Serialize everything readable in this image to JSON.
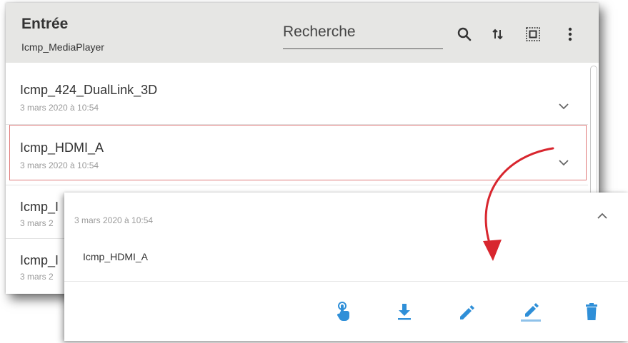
{
  "header": {
    "title": "Entrée",
    "subtitle": "Icmp_MediaPlayer",
    "search_placeholder": "Recherche",
    "icons": [
      "search-icon",
      "sort-icon",
      "select-all-icon",
      "more-vertical-icon"
    ]
  },
  "list": [
    {
      "name": "Icmp_424_DualLink_3D",
      "date": "3 mars 2020 à 10:54"
    },
    {
      "name": "Icmp_HDMI_A",
      "date": "3 mars 2020 à 10:54",
      "selected": true
    },
    {
      "name": "Icmp_I",
      "date": "3 mars 2"
    },
    {
      "name": "Icmp_I",
      "date": "3 mars 2"
    }
  ],
  "popup": {
    "date": "3 mars 2020 à 10:54",
    "name": "Icmp_HDMI_A",
    "actions": [
      "touch-icon",
      "download-icon",
      "edit-icon",
      "edit-underlined-icon",
      "delete-icon"
    ]
  },
  "colors": {
    "header_bg": "#e6e6e4",
    "action_blue": "#2f8fd8",
    "highlight_red": "#e07a7a",
    "arrow_red": "#d8262e"
  }
}
